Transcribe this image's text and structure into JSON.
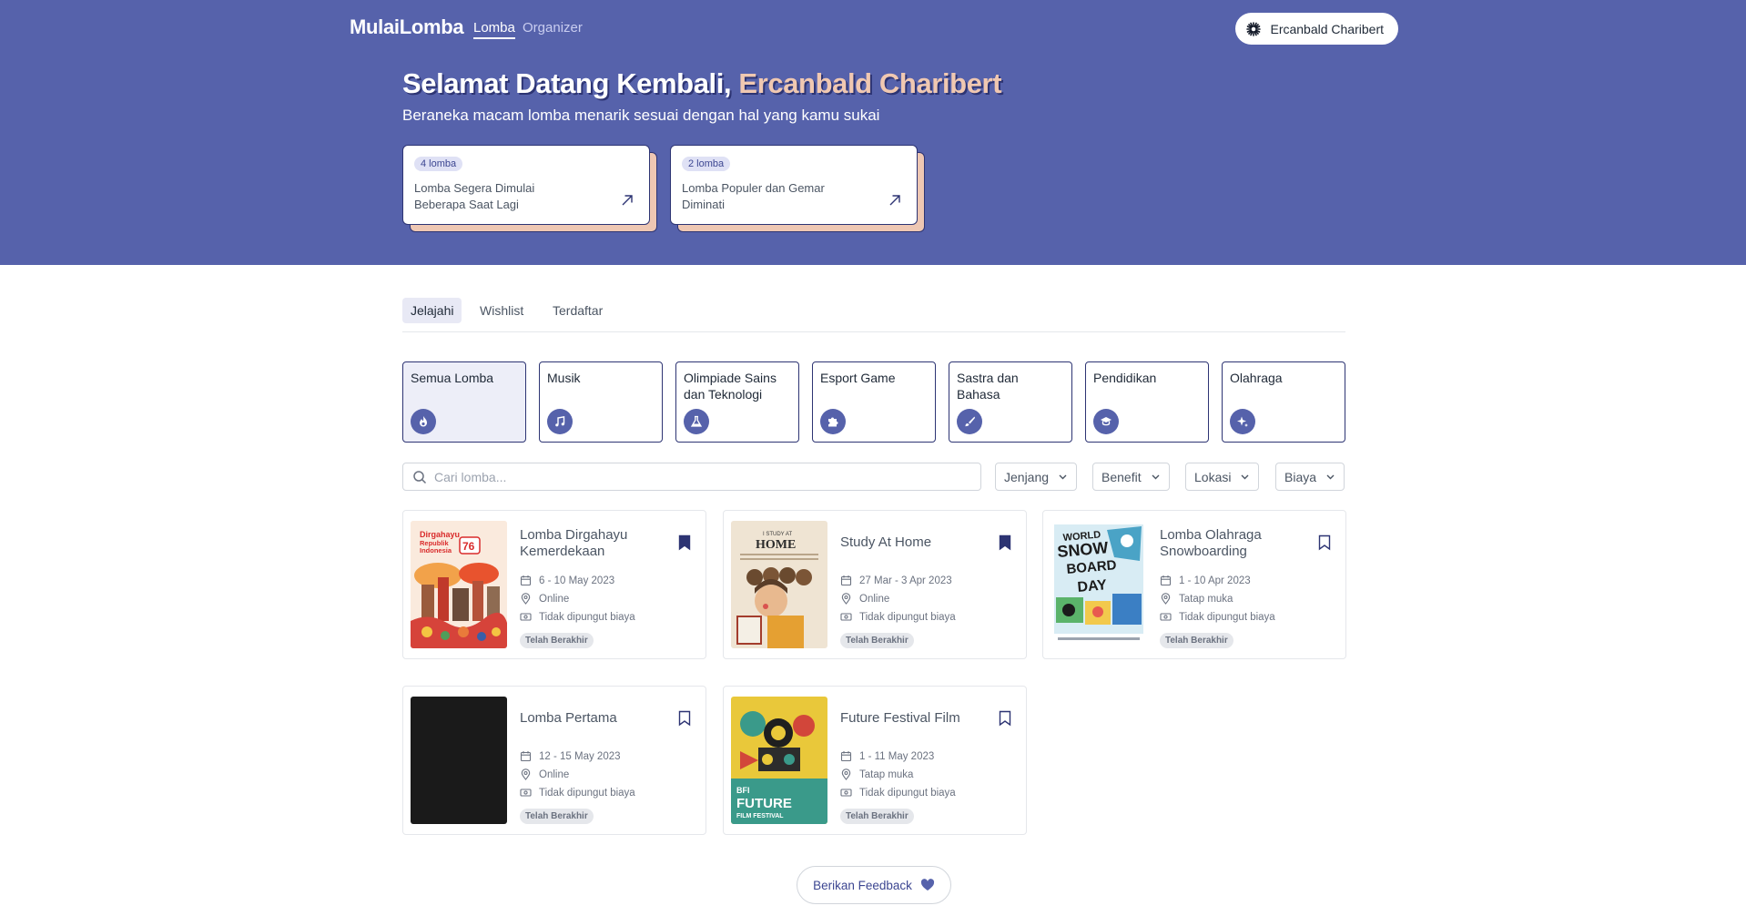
{
  "nav": {
    "brand": "MulaiLomba",
    "links": [
      "Lomba",
      "Organizer"
    ],
    "user_name": "Ercanbald Charibert"
  },
  "hero": {
    "greeting": "Selamat Datang Kembali, ",
    "name": "Ercanbald Charibert",
    "subtitle": "Beraneka macam lomba menarik sesuai dengan hal yang kamu sukai",
    "cards": [
      {
        "badge": "4 lomba",
        "text": "Lomba Segera Dimulai Beberapa Saat Lagi"
      },
      {
        "badge": "2 lomba",
        "text": "Lomba Populer dan Gemar Diminati"
      }
    ]
  },
  "tabs": [
    "Jelajahi",
    "Wishlist",
    "Terdaftar"
  ],
  "categories": [
    {
      "label": "Semua Lomba",
      "icon": "fire-icon"
    },
    {
      "label": "Musik",
      "icon": "music-icon"
    },
    {
      "label": "Olimpiade Sains dan Teknologi",
      "icon": "flask-icon"
    },
    {
      "label": "Esport Game",
      "icon": "puzzle-icon"
    },
    {
      "label": "Sastra dan Bahasa",
      "icon": "brush-icon"
    },
    {
      "label": "Pendidikan",
      "icon": "graduation-cap-icon"
    },
    {
      "label": "Olahraga",
      "icon": "sparkle-icon"
    }
  ],
  "search": {
    "placeholder": "Cari lomba..."
  },
  "filters": [
    "Jenjang",
    "Benefit",
    "Lokasi",
    "Biaya"
  ],
  "competitions": [
    {
      "title": "Lomba Dirgahayu Kemerdekaan",
      "date": "6 - 10 May 2023",
      "location": "Online",
      "fee": "Tidak dipungut biaya",
      "status": "Telah Berakhir",
      "saved": true
    },
    {
      "title": "Study At Home",
      "date": "27 Mar - 3 Apr 2023",
      "location": "Online",
      "fee": "Tidak dipungut biaya",
      "status": "Telah Berakhir",
      "saved": true
    },
    {
      "title": "Lomba Olahraga Snowboarding",
      "date": "1 - 10 Apr 2023",
      "location": "Tatap muka",
      "fee": "Tidak dipungut biaya",
      "status": "Telah Berakhir",
      "saved": false
    },
    {
      "title": "Lomba Pertama",
      "date": "12 - 15 May 2023",
      "location": "Online",
      "fee": "Tidak dipungut biaya",
      "status": "Telah Berakhir",
      "saved": false
    },
    {
      "title": "Future Festival Film",
      "date": "1 - 11 May 2023",
      "location": "Tatap muka",
      "fee": "Tidak dipungut biaya",
      "status": "Telah Berakhir",
      "saved": false
    }
  ],
  "poster_text": {
    "dirgahayu": [
      "Dirgahayu",
      "Republik",
      "Indonesia",
      "76"
    ],
    "study": [
      "I STUDY AT",
      "HOME"
    ],
    "snow": [
      "WORLD",
      "SNOW",
      "BOARD",
      "DAY"
    ],
    "film": [
      "BFI",
      "FUTURE",
      "FILM FESTIVAL"
    ]
  },
  "feedback_label": "Berikan Feedback",
  "colors": {
    "primary": "#5662ab",
    "accent": "#f0c8b1",
    "dark": "#2d3473"
  }
}
